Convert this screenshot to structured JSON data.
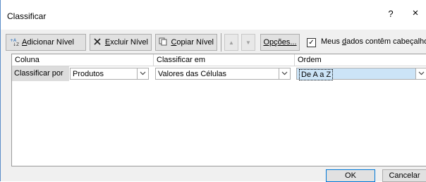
{
  "window": {
    "title": "Classificar",
    "help_label": "?",
    "close_label": "×"
  },
  "toolbar": {
    "add_level": {
      "prefix": "",
      "underlined": "A",
      "rest": "dicionar Nível",
      "icon": "add-level-icon"
    },
    "delete_level": {
      "prefix": "",
      "underlined": "E",
      "rest": "xcluir Nível",
      "icon": "delete-x-icon"
    },
    "copy_level": {
      "prefix": "",
      "underlined": "C",
      "rest": "opiar Nível",
      "icon": "copy-icon"
    },
    "move_up_label": "▲",
    "move_down_label": "▼",
    "options": {
      "prefix": "Op",
      "underlined": "ç",
      "rest": "ões..."
    },
    "header_checkbox": {
      "checked": true,
      "mark": "✓",
      "prefix": "Meus ",
      "underlined": "d",
      "rest": "ados contêm cabeçalhos"
    }
  },
  "grid": {
    "columns": [
      "Coluna",
      "Classificar em",
      "Ordem"
    ],
    "row": {
      "label": "Classificar por",
      "column_value": "Produtos",
      "sort_on_value": "Valores das Células",
      "order_value": "De A a Z"
    }
  },
  "footer": {
    "ok_label": "OK",
    "cancel_label": "Cancelar"
  }
}
